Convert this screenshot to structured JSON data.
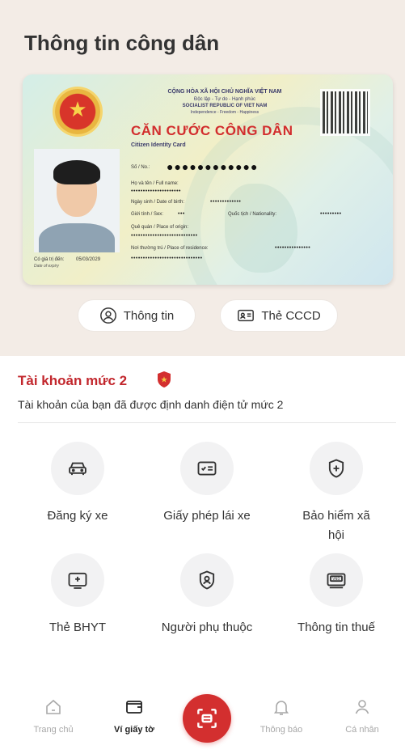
{
  "page": {
    "title": "Thông tin công dân"
  },
  "card": {
    "header_line1": "CỘNG HÒA XÃ HỘI CHỦ NGHĨA VIỆT NAM",
    "header_line2": "Độc lập - Tự do - Hạnh phúc",
    "header_line3": "SOCIALIST REPUBLIC OF VIET NAM",
    "header_line4": "Independence - Freedom - Happiness",
    "title": "CĂN CƯỚC CÔNG DÂN",
    "subtitle": "Citizen Identity Card",
    "number_label": "Số / No.:",
    "number_value": "●●●●●●●●●●●●",
    "name_label": "Họ và tên / Full name:",
    "name_value": "•••••••••••••••••••••",
    "dob_label": "Ngày sinh / Date of birth:",
    "dob_value": "•••••••••••••",
    "sex_label": "Giới tính / Sex:",
    "sex_value": "•••",
    "nationality_label": "Quốc tịch / Nationality:",
    "nationality_value": "•••••••••",
    "origin_label": "Quê quán / Place of origin:",
    "origin_value": "••••••••••••••••••••••••••••",
    "residence_label": "Nơi thường trú / Place of residence:",
    "residence_value1": "•••••••••••••••",
    "residence_value2": "••••••••••••••••••••••••••••••",
    "expiry_label": "Có giá trị đến:",
    "expiry_value": "05/03/2029",
    "expiry_label_en": "Date of expiry"
  },
  "buttons": {
    "info": "Thông tin",
    "card": "Thẻ CCCD"
  },
  "account": {
    "title": "Tài khoản mức 2",
    "description": "Tài khoản của bạn đã được định danh điện tử mức 2"
  },
  "services": [
    {
      "label": "Đăng ký xe",
      "icon": "car-icon"
    },
    {
      "label": "Giấy phép lái xe",
      "icon": "license-icon"
    },
    {
      "label": "Bảo hiểm xã hội",
      "icon": "shield-plus-icon"
    },
    {
      "label": "Thẻ BHYT",
      "icon": "health-card-icon"
    },
    {
      "label": "Người phụ thuộc",
      "icon": "dependent-icon"
    },
    {
      "label": "Thông tin thuế",
      "icon": "tax-icon"
    }
  ],
  "nav": {
    "home": "Trang chủ",
    "wallet": "Ví giấy tờ",
    "notify": "Thông báo",
    "profile": "Cá nhân"
  },
  "colors": {
    "accent": "#d32f2f",
    "account_title": "#c2272d"
  }
}
